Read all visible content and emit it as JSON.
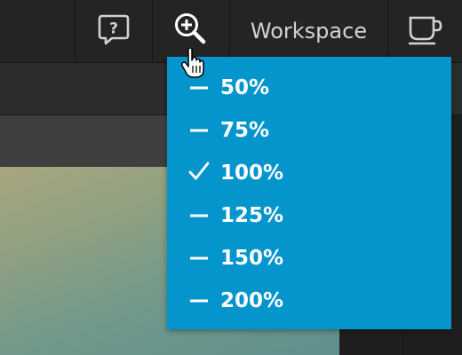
{
  "toolbar": {
    "help_icon": "help-question-icon",
    "zoom_icon": "zoom-in-icon",
    "workspace_label": "Workspace",
    "cup_icon": "coffee-cup-icon"
  },
  "zoom_menu": {
    "items": [
      {
        "label": "50%",
        "selected": false
      },
      {
        "label": "75%",
        "selected": false
      },
      {
        "label": "100%",
        "selected": true
      },
      {
        "label": "125%",
        "selected": false
      },
      {
        "label": "150%",
        "selected": false
      },
      {
        "label": "200%",
        "selected": false
      }
    ]
  },
  "colors": {
    "menu_background": "#0595cd",
    "toolbar_background": "#242424",
    "icon_color": "#d2d2d2"
  }
}
